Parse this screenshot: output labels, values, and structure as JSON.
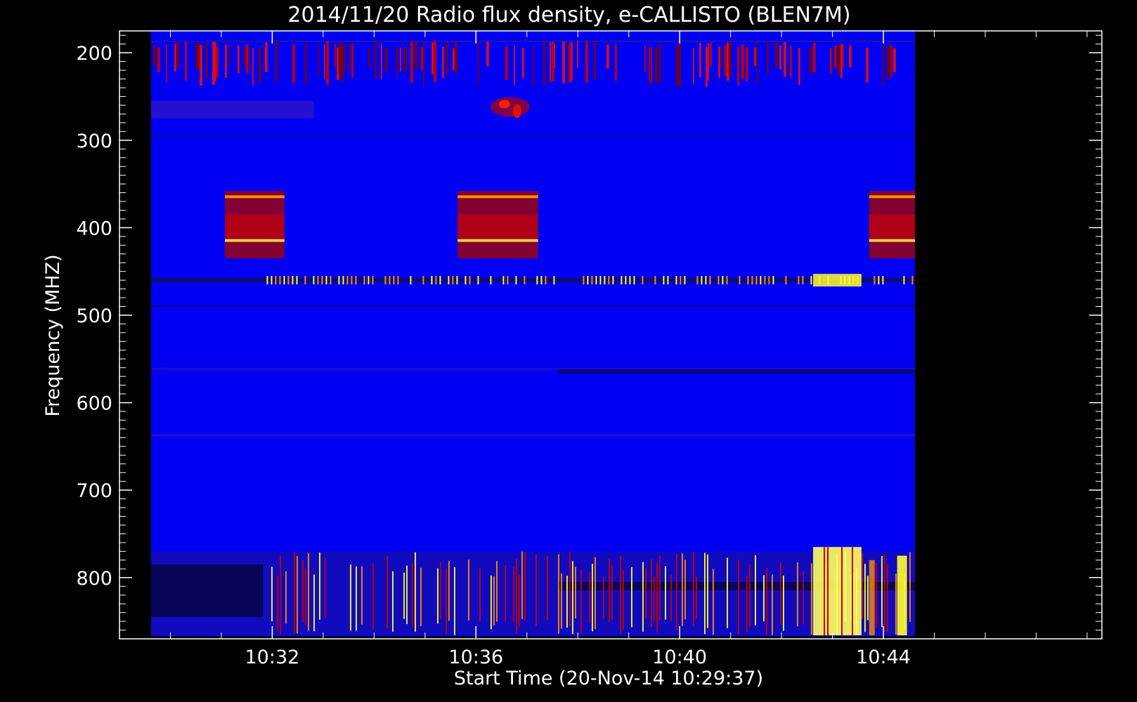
{
  "chart_data": {
    "type": "heatmap",
    "title": "2014/11/20  Radio flux density, e-CALLISTO (BLEN7M)",
    "xlabel": "Start Time (20-Nov-14 10:29:37)",
    "ylabel": "Frequency (MHZ)",
    "x_tick_labels": [
      "10:32",
      "10:36",
      "10:40",
      "10:44"
    ],
    "y_tick_labels": [
      "200",
      "300",
      "400",
      "500",
      "600",
      "700",
      "800"
    ],
    "time_range_minutes": [
      -0.62,
      18.67
    ],
    "data_time_range_minutes": [
      0,
      15
    ],
    "x_tick_minutes": [
      2.38,
      6.38,
      10.38,
      14.38
    ],
    "y_ticks_mhz": [
      200,
      300,
      400,
      500,
      600,
      700,
      800
    ],
    "ylim": [
      175,
      870
    ],
    "data_freq_range": [
      175,
      867
    ],
    "y_inverted": true,
    "colormap": "blue-red-yellow (IDL rainbow)",
    "background_color": "#0000f2",
    "features": [
      {
        "kind": "calibration_block",
        "t_start": 1.45,
        "t_end": 2.62,
        "f_start": 358,
        "f_end": 425
      },
      {
        "kind": "calibration_block",
        "t_start": 6.02,
        "t_end": 7.6,
        "f_start": 358,
        "f_end": 425
      },
      {
        "kind": "calibration_block",
        "t_start": 14.1,
        "t_end": 15.0,
        "f_start": 358,
        "f_end": 425
      },
      {
        "kind": "rfi_band",
        "f_start": 185,
        "f_end": 240,
        "intensity": "red"
      },
      {
        "kind": "rfi_line",
        "f": 460,
        "intensity": "yellow"
      },
      {
        "kind": "rfi_band",
        "f_start": 770,
        "f_end": 866,
        "intensity": "red-yellow"
      },
      {
        "kind": "burst",
        "t_start": 13.0,
        "t_end": 13.95,
        "f_start": 765,
        "f_end": 866,
        "intensity": "yellow"
      },
      {
        "kind": "small_burst",
        "t": 7.05,
        "f": 262,
        "intensity": "red"
      }
    ]
  }
}
